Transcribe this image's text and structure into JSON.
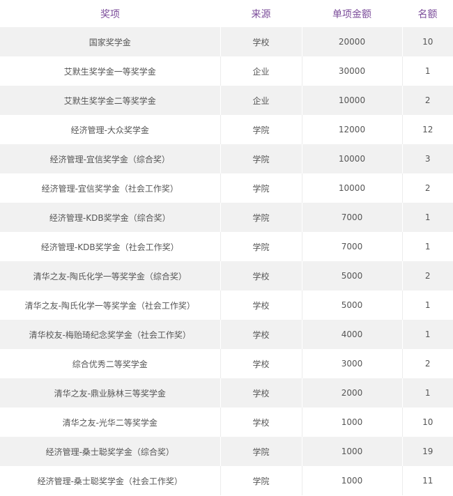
{
  "table": {
    "headers": [
      "奖项",
      "来源",
      "单项金额",
      "名额"
    ],
    "rows": [
      [
        "国家奖学金",
        "学校",
        "20000",
        "10"
      ],
      [
        "艾默生奖学金一等奖学金",
        "企业",
        "30000",
        "1"
      ],
      [
        "艾默生奖学金二等奖学金",
        "企业",
        "10000",
        "2"
      ],
      [
        "经济管理-大众奖学金",
        "学院",
        "12000",
        "12"
      ],
      [
        "经济管理-宜信奖学金（综合奖）",
        "学院",
        "10000",
        "3"
      ],
      [
        "经济管理-宜信奖学金（社会工作奖）",
        "学院",
        "10000",
        "2"
      ],
      [
        "经济管理-KDB奖学金（综合奖）",
        "学院",
        "7000",
        "1"
      ],
      [
        "经济管理-KDB奖学金（社会工作奖）",
        "学院",
        "7000",
        "1"
      ],
      [
        "清华之友-陶氏化学一等奖学金（综合奖）",
        "学校",
        "5000",
        "2"
      ],
      [
        "清华之友-陶氏化学一等奖学金（社会工作奖）",
        "学校",
        "5000",
        "1"
      ],
      [
        "清华校友-梅贻琦纪念奖学金（社会工作奖）",
        "学校",
        "4000",
        "1"
      ],
      [
        "综合优秀二等奖学金",
        "学校",
        "3000",
        "2"
      ],
      [
        "清华之友-鼎业脉林三等奖学金",
        "学校",
        "2000",
        "1"
      ],
      [
        "清华之友-光华二等奖学金",
        "学校",
        "1000",
        "10"
      ],
      [
        "经济管理-桑士聪奖学金（综合奖）",
        "学院",
        "1000",
        "19"
      ],
      [
        "经济管理-桑士聪奖学金（社会工作奖）",
        "学院",
        "1000",
        "11"
      ]
    ]
  },
  "colors": {
    "header_text": "#7b4c9a",
    "body_text": "#555555",
    "stripe": "#f1f1f1"
  }
}
